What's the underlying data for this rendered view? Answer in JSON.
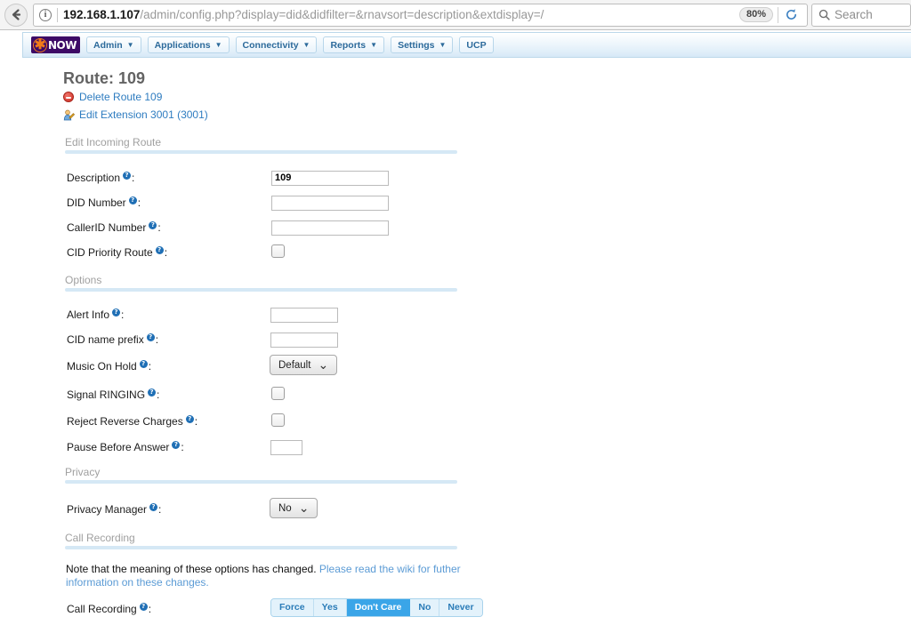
{
  "browser": {
    "back_icon": "back-arrow-icon",
    "info_icon": "site-info-icon",
    "url_host": "192.168.1.107",
    "url_path": "/admin/config.php?display=did&didfilter=&rnavsort=description&extdisplay=/",
    "zoom_level": "80%",
    "reload_icon": "reload-icon",
    "search_icon": "search-icon",
    "search_placeholder": "Search"
  },
  "navbar": {
    "logo_text": "NOW",
    "logo_star": "✱",
    "items": [
      {
        "label": "Admin",
        "has_caret": true
      },
      {
        "label": "Applications",
        "has_caret": true
      },
      {
        "label": "Connectivity",
        "has_caret": true
      },
      {
        "label": "Reports",
        "has_caret": true
      },
      {
        "label": "Settings",
        "has_caret": true
      },
      {
        "label": "UCP",
        "has_caret": false
      }
    ]
  },
  "page": {
    "title": "Route: 109",
    "delete_link": "Delete Route 109",
    "edit_extension_link": "Edit Extension 3001 (3001)"
  },
  "sections": {
    "edit_incoming_route": "Edit Incoming Route",
    "options": "Options",
    "privacy": "Privacy",
    "call_recording": "Call Recording"
  },
  "fields": {
    "description": {
      "label": "Description",
      "value": "109"
    },
    "did_number": {
      "label": "DID Number",
      "value": ""
    },
    "callerid_number": {
      "label": "CallerID Number",
      "value": ""
    },
    "cid_priority_route": {
      "label": "CID Priority Route",
      "checked": false
    },
    "alert_info": {
      "label": "Alert Info",
      "value": ""
    },
    "cid_name_prefix": {
      "label": "CID name prefix",
      "value": ""
    },
    "music_on_hold": {
      "label": "Music On Hold",
      "value": "Default"
    },
    "signal_ringing": {
      "label": "Signal RINGING",
      "checked": false
    },
    "reject_reverse": {
      "label": "Reject Reverse Charges",
      "checked": false
    },
    "pause_before_answer": {
      "label": "Pause Before Answer",
      "value": ""
    },
    "privacy_manager": {
      "label": "Privacy Manager",
      "value": "No"
    },
    "call_recording": {
      "label": "Call Recording"
    }
  },
  "call_recording_note": {
    "plain": "Note that the meaning of these options has changed. ",
    "link": "Please read the wiki for futher information on these changes."
  },
  "call_recording_options": [
    {
      "label": "Force",
      "selected": false
    },
    {
      "label": "Yes",
      "selected": false
    },
    {
      "label": "Don't Care",
      "selected": true
    },
    {
      "label": "No",
      "selected": false
    },
    {
      "label": "Never",
      "selected": false
    }
  ],
  "colors": {
    "accent_blue": "#3aa5e8",
    "link_blue": "#2e7cc0",
    "help_icon_blue": "#1f6fb5",
    "section_bar": "#d5e8f5",
    "logo_purple": "#3d0a66",
    "logo_orange": "#f07a1a"
  }
}
